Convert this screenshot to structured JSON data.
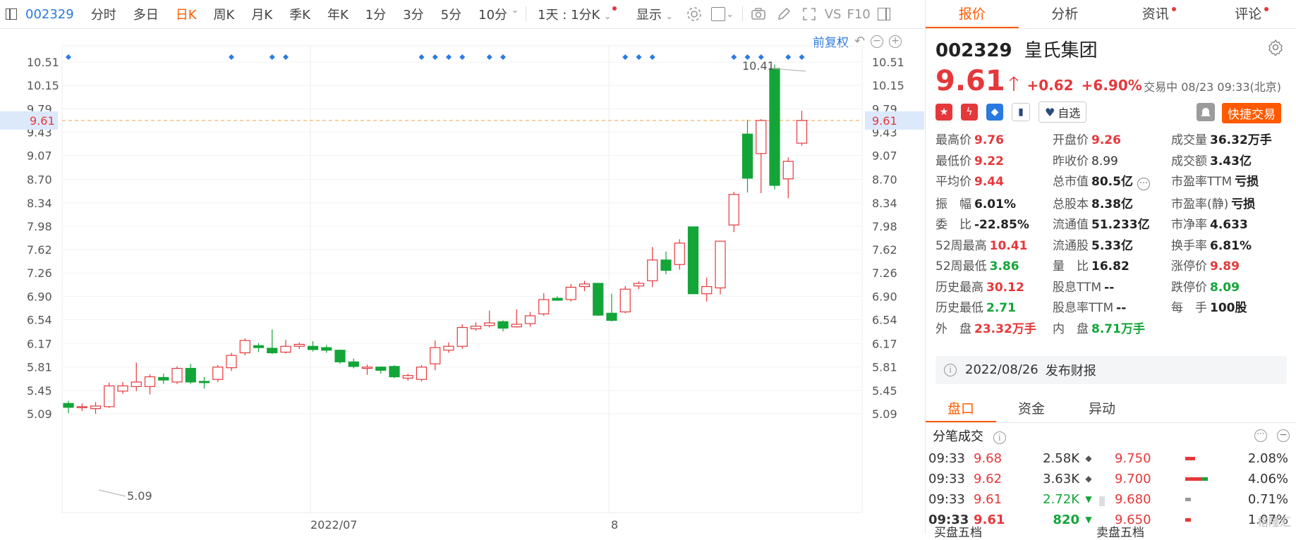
{
  "toolbar": {
    "code": "002329",
    "items": [
      "分时",
      "多日",
      "日K",
      "周K",
      "月K",
      "季K",
      "年K",
      "1分",
      "3分",
      "5分",
      "10分"
    ],
    "active": "日K",
    "range": "1天 : 1分K",
    "display": "显示",
    "vs": "VS",
    "f10": "F10"
  },
  "chart_controls": {
    "fq": "前复权"
  },
  "chart_data": {
    "type": "candlestick",
    "y_ticks": [
      "10.51",
      "10.15",
      "9.79",
      "9.43",
      "9.07",
      "8.70",
      "8.34",
      "7.98",
      "7.62",
      "7.26",
      "6.90",
      "6.54",
      "6.17",
      "5.81",
      "5.45",
      "5.09"
    ],
    "x_ticks": [
      "2022/07",
      "8"
    ],
    "current_price_label": "9.61",
    "high_label": "10.41",
    "low_label": "5.09",
    "candles": [
      {
        "o": 5.25,
        "c": 5.19,
        "h": 5.29,
        "l": 5.1
      },
      {
        "o": 5.19,
        "c": 5.2,
        "h": 5.25,
        "l": 5.13
      },
      {
        "o": 5.17,
        "c": 5.21,
        "h": 5.27,
        "l": 5.09
      },
      {
        "o": 5.2,
        "c": 5.52,
        "h": 5.57,
        "l": 5.18
      },
      {
        "o": 5.44,
        "c": 5.52,
        "h": 5.58,
        "l": 5.4
      },
      {
        "o": 5.51,
        "c": 5.58,
        "h": 5.88,
        "l": 5.44
      },
      {
        "o": 5.51,
        "c": 5.66,
        "h": 5.7,
        "l": 5.39
      },
      {
        "o": 5.65,
        "c": 5.61,
        "h": 5.71,
        "l": 5.55
      },
      {
        "o": 5.58,
        "c": 5.79,
        "h": 5.82,
        "l": 5.55
      },
      {
        "o": 5.79,
        "c": 5.58,
        "h": 5.86,
        "l": 5.55
      },
      {
        "o": 5.59,
        "c": 5.57,
        "h": 5.66,
        "l": 5.48
      },
      {
        "o": 5.62,
        "c": 5.81,
        "h": 5.84,
        "l": 5.58
      },
      {
        "o": 5.8,
        "c": 5.99,
        "h": 6.03,
        "l": 5.75
      },
      {
        "o": 6.03,
        "c": 6.22,
        "h": 6.25,
        "l": 5.99
      },
      {
        "o": 6.14,
        "c": 6.11,
        "h": 6.18,
        "l": 6.04
      },
      {
        "o": 6.1,
        "c": 6.03,
        "h": 6.39,
        "l": 6.01
      },
      {
        "o": 6.04,
        "c": 6.13,
        "h": 6.23,
        "l": 6.02
      },
      {
        "o": 6.13,
        "c": 6.16,
        "h": 6.19,
        "l": 6.09
      },
      {
        "o": 6.13,
        "c": 6.08,
        "h": 6.21,
        "l": 6.05
      },
      {
        "o": 6.11,
        "c": 6.07,
        "h": 6.15,
        "l": 6.03
      },
      {
        "o": 6.07,
        "c": 5.89,
        "h": 6.08,
        "l": 5.86
      },
      {
        "o": 5.89,
        "c": 5.82,
        "h": 5.94,
        "l": 5.79
      },
      {
        "o": 5.79,
        "c": 5.81,
        "h": 5.85,
        "l": 5.69
      },
      {
        "o": 5.81,
        "c": 5.76,
        "h": 5.82,
        "l": 5.71
      },
      {
        "o": 5.82,
        "c": 5.66,
        "h": 5.84,
        "l": 5.64
      },
      {
        "o": 5.64,
        "c": 5.68,
        "h": 5.71,
        "l": 5.6
      },
      {
        "o": 5.62,
        "c": 5.81,
        "h": 5.84,
        "l": 5.59
      },
      {
        "o": 5.86,
        "c": 6.11,
        "h": 6.22,
        "l": 5.76
      },
      {
        "o": 6.07,
        "c": 6.13,
        "h": 6.19,
        "l": 6.03
      },
      {
        "o": 6.13,
        "c": 6.42,
        "h": 6.47,
        "l": 6.09
      },
      {
        "o": 6.4,
        "c": 6.44,
        "h": 6.5,
        "l": 6.37
      },
      {
        "o": 6.45,
        "c": 6.49,
        "h": 6.68,
        "l": 6.42
      },
      {
        "o": 6.51,
        "c": 6.41,
        "h": 6.53,
        "l": 6.36
      },
      {
        "o": 6.43,
        "c": 6.47,
        "h": 6.7,
        "l": 6.42
      },
      {
        "o": 6.48,
        "c": 6.6,
        "h": 6.66,
        "l": 6.43
      },
      {
        "o": 6.63,
        "c": 6.85,
        "h": 6.95,
        "l": 6.6
      },
      {
        "o": 6.87,
        "c": 6.84,
        "h": 6.9,
        "l": 6.83
      },
      {
        "o": 6.85,
        "c": 7.04,
        "h": 7.09,
        "l": 6.82
      },
      {
        "o": 7.05,
        "c": 7.09,
        "h": 7.14,
        "l": 6.98
      },
      {
        "o": 7.1,
        "c": 6.61,
        "h": 7.1,
        "l": 6.6
      },
      {
        "o": 6.64,
        "c": 6.53,
        "h": 6.94,
        "l": 6.51
      },
      {
        "o": 6.66,
        "c": 7.01,
        "h": 7.06,
        "l": 6.64
      },
      {
        "o": 7.06,
        "c": 7.1,
        "h": 7.13,
        "l": 7.01
      },
      {
        "o": 7.14,
        "c": 7.46,
        "h": 7.66,
        "l": 7.04
      },
      {
        "o": 7.46,
        "c": 7.3,
        "h": 7.59,
        "l": 7.24
      },
      {
        "o": 7.39,
        "c": 7.72,
        "h": 7.78,
        "l": 7.31
      },
      {
        "o": 7.97,
        "c": 6.94,
        "h": 7.97,
        "l": 6.94
      },
      {
        "o": 6.94,
        "c": 7.05,
        "h": 7.19,
        "l": 6.82
      },
      {
        "o": 7.03,
        "c": 7.75,
        "h": 7.75,
        "l": 6.93
      },
      {
        "o": 8.0,
        "c": 8.47,
        "h": 8.51,
        "l": 7.89
      },
      {
        "o": 9.4,
        "c": 8.72,
        "h": 9.62,
        "l": 8.5
      },
      {
        "o": 9.1,
        "c": 9.61,
        "h": 9.63,
        "l": 8.49
      },
      {
        "o": 10.41,
        "c": 8.61,
        "h": 10.47,
        "l": 8.55
      },
      {
        "o": 8.71,
        "c": 8.98,
        "h": 9.04,
        "l": 8.41
      },
      {
        "o": 9.26,
        "c": 9.61,
        "h": 9.76,
        "l": 9.22
      }
    ],
    "markers": [
      0,
      12,
      15,
      16,
      26,
      27,
      28,
      29,
      31,
      32,
      41,
      42,
      43,
      49,
      50,
      51,
      53,
      54
    ]
  },
  "panel": {
    "tabs": [
      {
        "label": "报价",
        "dot": false
      },
      {
        "label": "分析",
        "dot": false
      },
      {
        "label": "资讯",
        "dot": true
      },
      {
        "label": "评论",
        "dot": true
      }
    ],
    "code": "002329",
    "name": "皇氏集团",
    "price": "9.61",
    "change": "+0.62",
    "change_pct": "+6.90%",
    "status": "交易中 08/23 09:33(北京)",
    "fav": "自选",
    "fast_trade": "快捷交易",
    "quote": [
      [
        {
          "l": "最高价",
          "v": "9.76",
          "c": "red"
        },
        {
          "l": "开盘价",
          "v": "9.26",
          "c": "red"
        },
        {
          "l": "成交量",
          "v": "36.32万手",
          "c": "blk"
        }
      ],
      [
        {
          "l": "最低价",
          "v": "9.22",
          "c": "red"
        },
        {
          "l": "昨收价",
          "v": "8.99",
          "c": "norm"
        },
        {
          "l": "成交额",
          "v": "3.43亿",
          "c": "blk"
        }
      ],
      [
        {
          "l": "平均价",
          "v": "9.44",
          "c": "red"
        },
        {
          "l": "总市值",
          "v": "80.5亿",
          "c": "blk"
        },
        {
          "l": "市盈率TTM",
          "v": "亏损",
          "c": "blk"
        }
      ],
      [
        {
          "l": "振　幅",
          "v": "6.01%",
          "c": "blk"
        },
        {
          "l": "总股本",
          "v": "8.38亿",
          "c": "blk"
        },
        {
          "l": "市盈率(静)",
          "v": "亏损",
          "c": "blk"
        }
      ],
      [
        {
          "l": "委　比",
          "v": "-22.85%",
          "c": "blk"
        },
        {
          "l": "流通值",
          "v": "51.233亿",
          "c": "blk"
        },
        {
          "l": "市净率",
          "v": "4.633",
          "c": "blk"
        }
      ],
      [
        {
          "l": "52周最高",
          "v": "10.41",
          "c": "red"
        },
        {
          "l": "流通股",
          "v": "5.33亿",
          "c": "blk"
        },
        {
          "l": "换手率",
          "v": "6.81%",
          "c": "blk"
        }
      ],
      [
        {
          "l": "52周最低",
          "v": "3.86",
          "c": "green"
        },
        {
          "l": "量　比",
          "v": "16.82",
          "c": "blk"
        },
        {
          "l": "涨停价",
          "v": "9.89",
          "c": "red"
        }
      ],
      [
        {
          "l": "历史最高",
          "v": "30.12",
          "c": "red"
        },
        {
          "l": "股息TTM",
          "v": "--",
          "c": "blk"
        },
        {
          "l": "跌停价",
          "v": "8.09",
          "c": "green"
        }
      ],
      [
        {
          "l": "历史最低",
          "v": "2.71",
          "c": "green"
        },
        {
          "l": "股息率TTM",
          "v": "--",
          "c": "blk"
        },
        {
          "l": "每　手",
          "v": "100股",
          "c": "blk"
        }
      ],
      [
        {
          "l": "外　盘",
          "v": "23.32万手",
          "c": "red"
        },
        {
          "l": "内　盘",
          "v": "8.71万手",
          "c": "green"
        },
        {
          "l": "",
          "v": "",
          "c": "blk"
        }
      ]
    ],
    "report_date": "2022/08/26",
    "report_text": "发布财报",
    "tabs2": [
      "盘口",
      "资金",
      "异动"
    ],
    "ticks_title": "分笔成交",
    "ticks": [
      {
        "t": "09:33",
        "p": "9.68",
        "v": "2.58K",
        "dir": "n"
      },
      {
        "t": "09:33",
        "p": "9.62",
        "v": "3.63K",
        "dir": "n"
      },
      {
        "t": "09:33",
        "p": "9.61",
        "v": "2.72K",
        "dir": "d"
      },
      {
        "t": "09:33",
        "p": "9.61",
        "v": "820",
        "dir": "d"
      }
    ],
    "dist": [
      {
        "p": "9.750",
        "pct": "2.08%"
      },
      {
        "p": "9.700",
        "pct": "4.06%"
      },
      {
        "p": "9.680",
        "pct": "0.71%"
      },
      {
        "p": "9.650",
        "pct": "1.07%"
      }
    ],
    "buy5": "买盘五档",
    "sell5": "卖盘五档",
    "watermark": "格隆汇"
  }
}
